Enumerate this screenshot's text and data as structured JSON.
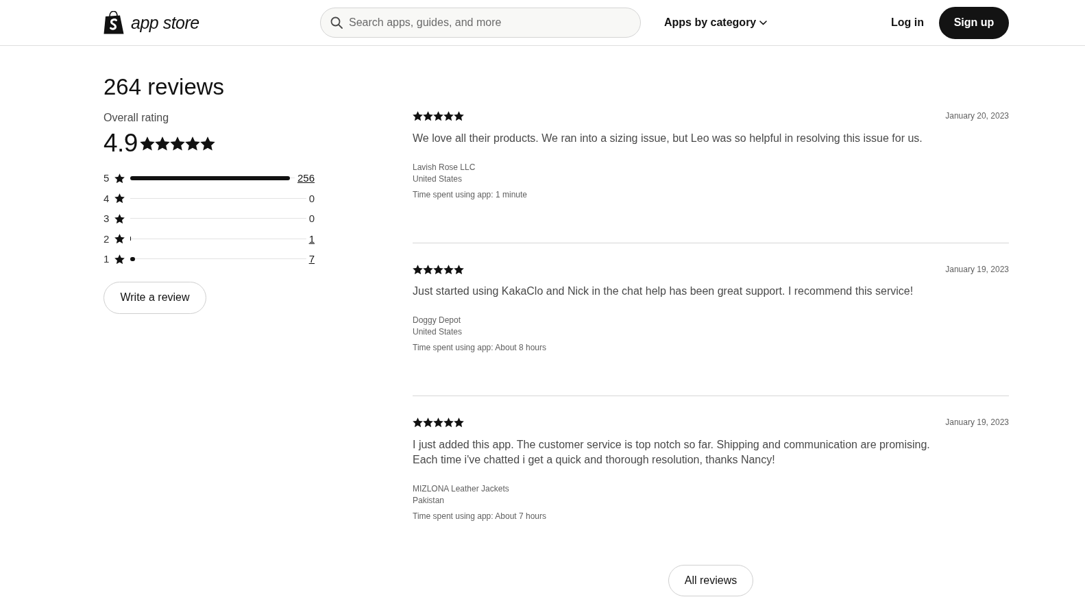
{
  "header": {
    "logo_text": "app store",
    "search": {
      "placeholder": "Search apps, guides, and more"
    },
    "category_menu": "Apps by category",
    "login": "Log in",
    "signup": "Sign up"
  },
  "summary": {
    "title": "264 reviews",
    "overall_label": "Overall rating",
    "rating": "4.9",
    "stars": 5,
    "distribution": [
      {
        "rating": "5",
        "level": 0.97,
        "count": "256",
        "linked": true
      },
      {
        "rating": "4",
        "count": "0",
        "linked": false
      },
      {
        "rating": "3",
        "count": "0",
        "linked": false
      },
      {
        "rating": "2",
        "level": 0.004,
        "count": "1",
        "linked": true
      },
      {
        "rating": "1",
        "level": 0.027,
        "count": "7",
        "linked": true
      }
    ],
    "write_button": "Write a review"
  },
  "reviews": [
    {
      "stars": 5,
      "date": "January 20, 2023",
      "text": "We love all their products. We ran into a sizing issue, but Leo was so helpful in resolving this issue for us.",
      "author": "Lavish Rose LLC",
      "location": "United States",
      "time_spent": "Time spent using app: 1 minute"
    },
    {
      "stars": 5,
      "date": "January 19, 2023",
      "text": "Just started using KakaClo and Nick in the chat help has been great support. I recommend this service!",
      "author": "Doggy Depot",
      "location": "United States",
      "time_spent": "Time spent using app: About 8 hours"
    },
    {
      "stars": 5,
      "date": "January 19, 2023",
      "text": "I just added this app. The customer service is top notch so far. Shipping and communication are promising.\nEach time i've chatted i get a quick and thorough resolution, thanks Nancy!",
      "author": "MIZLONA Leather Jackets",
      "location": "Pakistan",
      "time_spent": "Time spent using app: About 7 hours"
    }
  ],
  "all_reviews_button": "All reviews"
}
